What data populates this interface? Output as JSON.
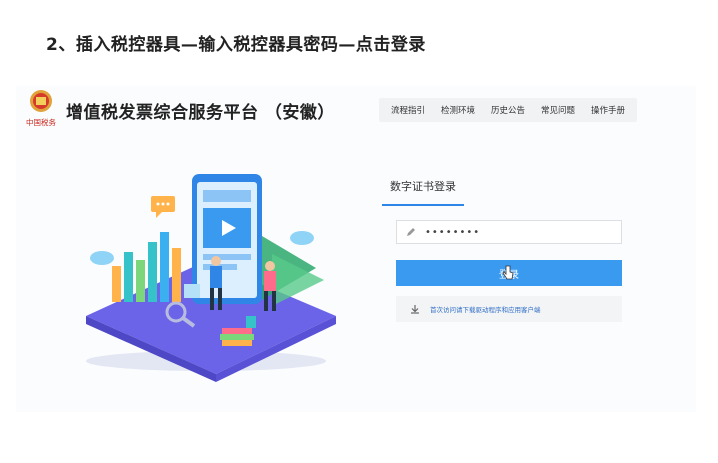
{
  "heading": "2、插入税控器具—输入税控器具密码—点击登录",
  "site": {
    "title": "增值税发票综合服务平台 （安徽）",
    "logo_caption": "中国税务"
  },
  "nav": {
    "items": [
      "流程指引",
      "检测环境",
      "历史公告",
      "常见问题",
      "操作手册"
    ]
  },
  "login": {
    "tab_label": "数字证书登录",
    "password_value": "••••••••",
    "button_label": "登录",
    "download_text": "首次访问请下载驱动程序和应用客户端"
  },
  "colors": {
    "accent": "#3a9af0",
    "link": "#2f6fc6",
    "platform": "#6b64e8"
  }
}
